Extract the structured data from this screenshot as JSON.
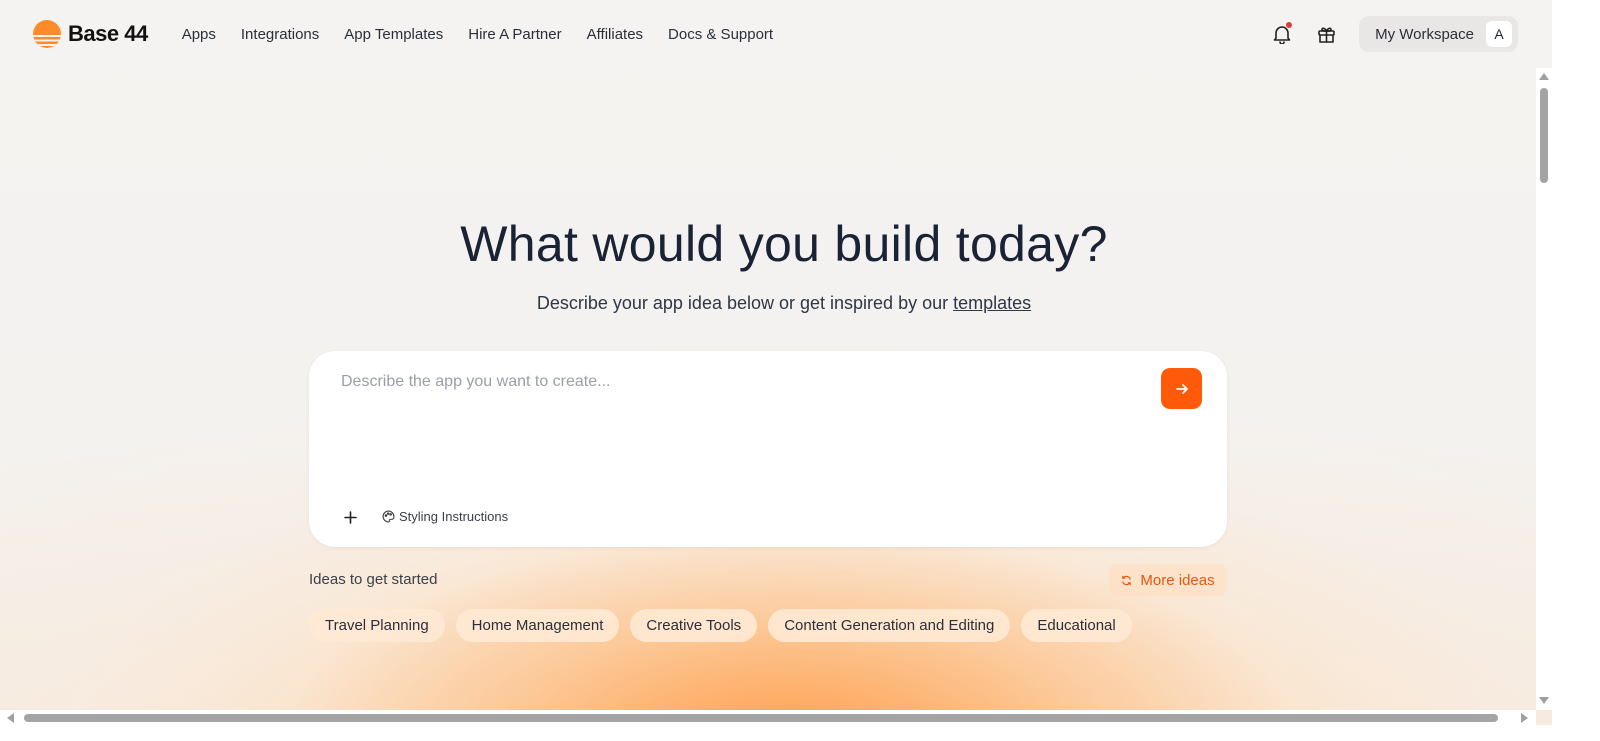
{
  "header": {
    "brand": "Base 44",
    "nav": [
      {
        "label": "Apps",
        "name": "apps"
      },
      {
        "label": "Integrations",
        "name": "integrations"
      },
      {
        "label": "App Templates",
        "name": "app-templates"
      },
      {
        "label": "Hire A Partner",
        "name": "hire-a-partner"
      },
      {
        "label": "Affiliates",
        "name": "affiliates"
      },
      {
        "label": "Docs & Support",
        "name": "docs-support"
      }
    ],
    "workspace_label": "My Workspace",
    "avatar_initial": "A",
    "icons": {
      "notifications": "bell-icon",
      "gift": "gift-icon"
    },
    "has_notification": true
  },
  "hero": {
    "title": "What would you build today?",
    "subtitle_prefix": "Describe your app idea below or get inspired by our ",
    "subtitle_link": "templates"
  },
  "prompt": {
    "placeholder": "Describe the app you want to create...",
    "value": "",
    "styling_label": "Styling Instructions",
    "icons": {
      "send": "arrow-right-icon",
      "add": "plus-icon",
      "styling": "palette-icon"
    }
  },
  "ideas": {
    "label": "Ideas to get started",
    "more_label": "More ideas",
    "chips": [
      "Travel Planning",
      "Home Management",
      "Creative Tools",
      "Content Generation and Editing",
      "Educational"
    ]
  },
  "colors": {
    "accent": "#ff5a0a",
    "accent_text": "#e8560e",
    "title": "#1a2235",
    "notification_dot": "#e53935"
  }
}
